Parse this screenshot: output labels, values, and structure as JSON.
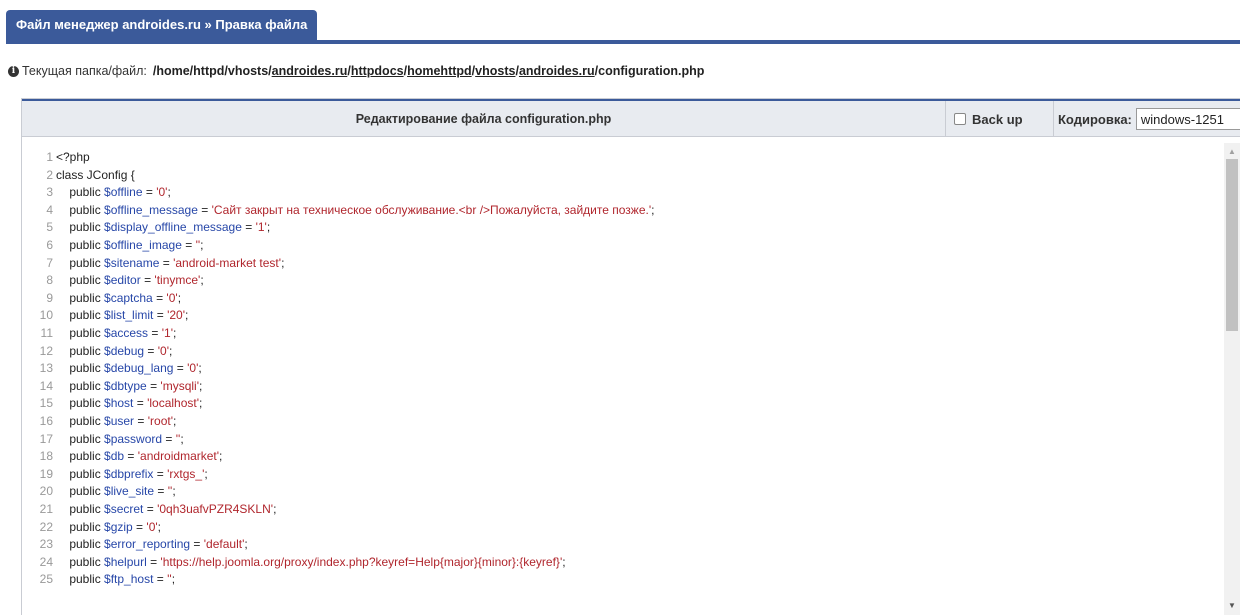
{
  "tab": {
    "title": "Файл менеджер androides.ru » Правка файла"
  },
  "path": {
    "label": "Текущая папка/файл:",
    "prefix": "/home/httpd/vhosts/",
    "segments": [
      "androides.ru",
      "httpdocs",
      "homehttpd",
      "vhosts",
      "androides.ru"
    ],
    "filename": "/configuration.php"
  },
  "editor": {
    "title": "Редактирование файла configuration.php",
    "backup_label": "Back up",
    "encoding_label": "Кодировка:",
    "encoding_value": "windows-1251"
  },
  "code_lines": [
    {
      "n": "1",
      "plain": "<?php"
    },
    {
      "n": "2",
      "plain": "class JConfig {"
    },
    {
      "n": "3",
      "var": "$offline",
      "val": "'0'"
    },
    {
      "n": "4",
      "var": "$offline_message",
      "val": "'Сайт закрыт на техническое обслуживание.<br />Пожалуйста, зайдите позже.'"
    },
    {
      "n": "5",
      "var": "$display_offline_message",
      "val": "'1'"
    },
    {
      "n": "6",
      "var": "$offline_image",
      "val": "''"
    },
    {
      "n": "7",
      "var": "$sitename",
      "val": "'android-market test'"
    },
    {
      "n": "8",
      "var": "$editor",
      "val": "'tinymce'"
    },
    {
      "n": "9",
      "var": "$captcha",
      "val": "'0'"
    },
    {
      "n": "10",
      "var": "$list_limit",
      "val": "'20'"
    },
    {
      "n": "11",
      "var": "$access",
      "val": "'1'"
    },
    {
      "n": "12",
      "var": "$debug",
      "val": "'0'"
    },
    {
      "n": "13",
      "var": "$debug_lang",
      "val": "'0'"
    },
    {
      "n": "14",
      "var": "$dbtype",
      "val": "'mysqli'"
    },
    {
      "n": "15",
      "var": "$host",
      "val": "'localhost'"
    },
    {
      "n": "16",
      "var": "$user",
      "val": "'root'"
    },
    {
      "n": "17",
      "var": "$password",
      "val": "''"
    },
    {
      "n": "18",
      "var": "$db",
      "val": "'androidmarket'"
    },
    {
      "n": "19",
      "var": "$dbprefix",
      "val": "'rxtgs_'"
    },
    {
      "n": "20",
      "var": "$live_site",
      "val": "''"
    },
    {
      "n": "21",
      "var": "$secret",
      "val": "'0qh3uafvPZR4SKLN'"
    },
    {
      "n": "22",
      "var": "$gzip",
      "val": "'0'"
    },
    {
      "n": "23",
      "var": "$error_reporting",
      "val": "'default'"
    },
    {
      "n": "24",
      "var": "$helpurl",
      "val": "'https://help.joomla.org/proxy/index.php?keyref=Help{major}{minor}:{keyref}'"
    },
    {
      "n": "25",
      "var": "$ftp_host",
      "val": "''"
    }
  ],
  "keyword": "public"
}
